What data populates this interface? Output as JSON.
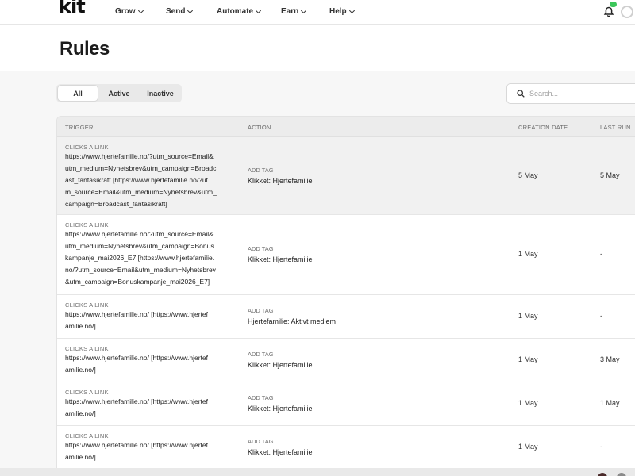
{
  "app": {
    "logo": "kit"
  },
  "nav": {
    "items": [
      {
        "label": "Grow"
      },
      {
        "label": "Send"
      },
      {
        "label": "Automate"
      },
      {
        "label": "Earn"
      },
      {
        "label": "Help"
      }
    ]
  },
  "page": {
    "title": "Rules"
  },
  "filters": {
    "tabs": [
      {
        "label": "All"
      },
      {
        "label": "Active"
      },
      {
        "label": "Inactive"
      }
    ],
    "selected": "All"
  },
  "search": {
    "placeholder": "Search...",
    "value": ""
  },
  "table": {
    "columns": {
      "trigger": "TRIGGER",
      "action": "ACTION",
      "created": "CREATION DATE",
      "last_run": "LAST RUN"
    },
    "rows": [
      {
        "trigger_type": "CLICKS A LINK",
        "trigger_lines": [
          "https://www.hjertefamilie.no/?utm_source=Email&",
          "utm_medium=Nyhetsbrev&utm_campaign=Broadc",
          "ast_fantasikraft [https://www.hjertefamilie.no/?ut",
          "m_source=Email&utm_medium=Nyhetsbrev&utm_",
          "campaign=Broadcast_fantasikraft]"
        ],
        "action_type": "ADD TAG",
        "action_value": "Klikket: Hjertefamilie",
        "created": "5 May",
        "last_run": "5 May"
      },
      {
        "trigger_type": "CLICKS A LINK",
        "trigger_lines": [
          "https://www.hjertefamilie.no/?utm_source=Email&",
          "utm_medium=Nyhetsbrev&utm_campaign=Bonus",
          "kampanje_mai2026_E7 [https://www.hjertefamilie.",
          "no/?utm_source=Email&utm_medium=Nyhetsbrev",
          "&utm_campaign=Bonuskampanje_mai2026_E7]"
        ],
        "action_type": "ADD TAG",
        "action_value": "Klikket: Hjertefamilie",
        "created": "1 May",
        "last_run": "-"
      },
      {
        "trigger_type": "CLICKS A LINK",
        "trigger_lines": [
          "https://www.hjertefamilie.no/ [https://www.hjertef",
          "amilie.no/]"
        ],
        "action_type": "ADD TAG",
        "action_value": "Hjertefamilie: Aktivt medlem",
        "created": "1 May",
        "last_run": "-"
      },
      {
        "trigger_type": "CLICKS A LINK",
        "trigger_lines": [
          "https://www.hjertefamilie.no/ [https://www.hjertef",
          "amilie.no/]"
        ],
        "action_type": "ADD TAG",
        "action_value": "Klikket: Hjertefamilie",
        "created": "1 May",
        "last_run": "3 May"
      },
      {
        "trigger_type": "CLICKS A LINK",
        "trigger_lines": [
          "https://www.hjertefamilie.no/ [https://www.hjertef",
          "amilie.no/]"
        ],
        "action_type": "ADD TAG",
        "action_value": "Klikket: Hjertefamilie",
        "created": "1 May",
        "last_run": "1 May"
      },
      {
        "trigger_type": "CLICKS A LINK",
        "trigger_lines": [
          "https://www.hjertefamilie.no/ [https://www.hjertef",
          "amilie.no/]"
        ],
        "action_type": "ADD TAG",
        "action_value": "Klikket: Hjertefamilie",
        "created": "1 May",
        "last_run": "-"
      }
    ]
  },
  "colors": {
    "accent_green": "#3cc65a",
    "table_header_bg": "#ececec",
    "highlight_row_bg": "#f1f1f1"
  }
}
